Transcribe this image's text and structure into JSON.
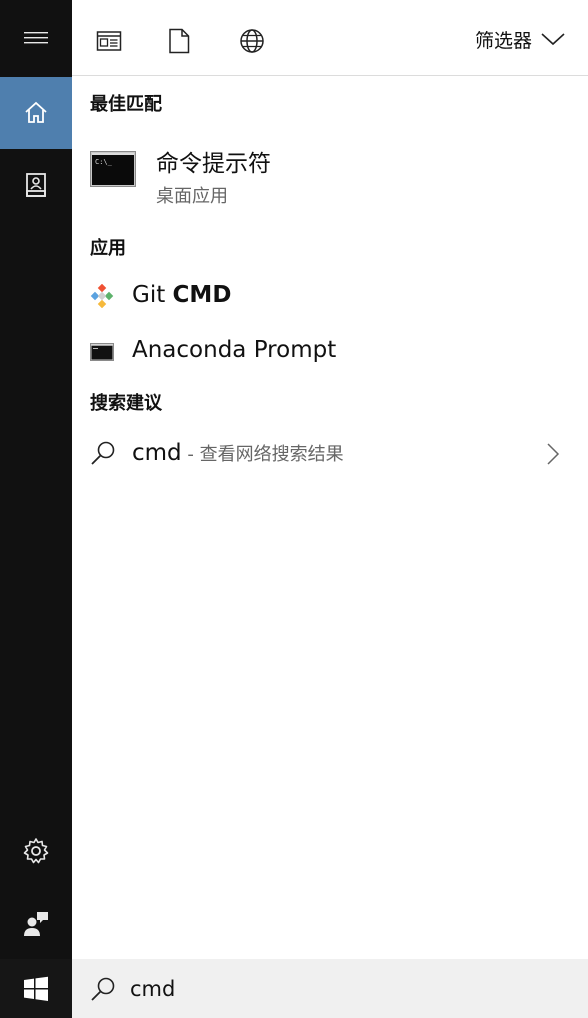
{
  "header": {
    "filter_label": "筛选器",
    "tools": [
      {
        "icon": "document-view-icon"
      },
      {
        "icon": "file-icon"
      },
      {
        "icon": "globe-icon"
      }
    ]
  },
  "rail": {
    "items": [
      {
        "icon": "home-icon",
        "active": true
      },
      {
        "icon": "notebook-icon",
        "active": false
      },
      {
        "icon": "gear-icon",
        "active": false
      },
      {
        "icon": "feedback-icon",
        "active": false
      }
    ]
  },
  "best_match": {
    "title": "最佳匹配",
    "item": {
      "name": "命令提示符",
      "subtitle": "桌面应用",
      "icon": "command-prompt-icon"
    }
  },
  "apps": {
    "title": "应用",
    "items": [
      {
        "name_normal": "Git ",
        "name_bold": "CMD",
        "icon": "git-icon"
      },
      {
        "name_normal": "Anaconda Prompt",
        "name_bold": "",
        "icon": "console-icon"
      }
    ]
  },
  "suggestions": {
    "title": "搜索建议",
    "items": [
      {
        "query": "cmd",
        "hint": " - 查看网络搜索结果",
        "icon": "search-icon"
      }
    ]
  },
  "taskbar": {
    "search_value": "cmd",
    "start_icon": "windows-logo-icon"
  },
  "colors": {
    "rail_bg": "#111111",
    "rail_active": "#4f7fae",
    "taskbar_search_bg": "#f0f0f0"
  }
}
